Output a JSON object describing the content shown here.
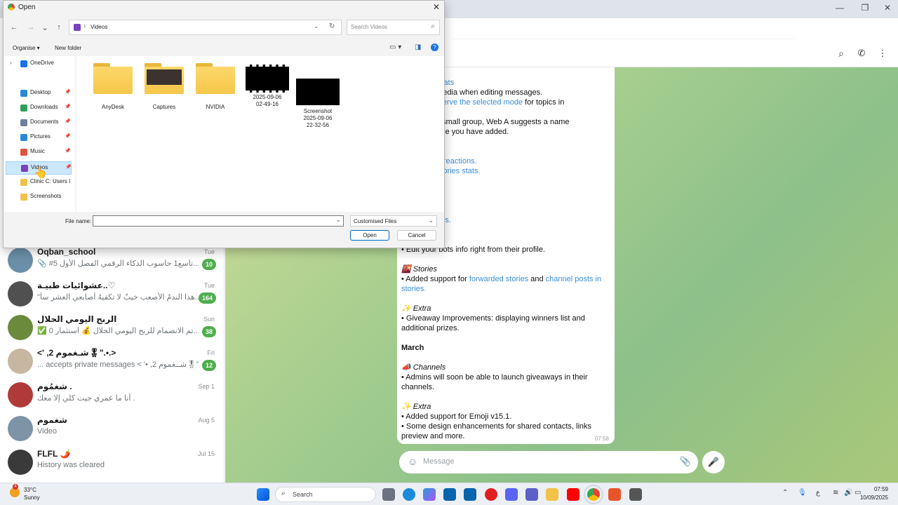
{
  "browser": {
    "profile_initial": "G",
    "icons": [
      "install-app-icon",
      "star-icon",
      "download-icon",
      "profile-avatar",
      "kebab-menu-icon"
    ]
  },
  "telegram": {
    "header_icons": [
      "search-icon",
      "phone-icon",
      "more-icon"
    ],
    "chats": [
      {
        "name": "Oqban_school",
        "message": "📎 #تاسع1 حاسوب الذكاء الرقمي الفصل الأول 5...",
        "time": "Tue",
        "badge": "10",
        "avatar_color": "#6b8fa8"
      },
      {
        "name": "عشوائيات طبيـة..♡",
        "message": "\"هذا الندمُ الأصعب خيبٌ لا تكفيهُ أصابعي العشر سأ...",
        "time": "Tue",
        "badge": "164",
        "avatar_color": "#505050"
      },
      {
        "name": "الربح اليومي الحلال",
        "message": "✅ تم الانضمام للربح اليومي الحلال 💰 استثمار 0...",
        "time": "Sun",
        "badge": "38",
        "avatar_color": "#6b8a3c"
      },
      {
        "name": "<' ,شـغموم 2🎖\".•.>",
        "message": "... accepts private messages < '• ,شــغموم 2🎖\"",
        "time": "Fri",
        "badge": "12",
        "avatar_color": "#c7b7a0"
      },
      {
        "name": "شغمُوم .",
        "message": "أنا ما عمري جيت كلي إلا معك .",
        "time": "Sep 1",
        "badge": "",
        "avatar_color": "#b03a3a"
      },
      {
        "name": "شغموم",
        "message": "Video",
        "time": "Aug 5",
        "badge": "",
        "avatar_color": "#7d93a6"
      },
      {
        "name": "FLFL 🌶️",
        "message": "History was cleared",
        "time": "Jul 15",
        "badge": "",
        "avatar_color": "#3a3a3a"
      }
    ],
    "bubble": {
      "time": "07:58",
      "lines": [
        {
          "text": "n Private Chats",
          "cls": "b-link"
        },
        {
          "text": "w replace media when editing messages.",
          "cls": ""
        },
        {
          "text": "rned to ",
          "cls": "",
          "link": "preserve the selected mode",
          "after": " for topics in"
        },
        {
          "text": "",
          "cls": ""
        },
        {
          "text": "ou create a small group, Web A suggests a name",
          "cls": ""
        },
        {
          "text": "n users' name you have added.",
          "cls": ""
        },
        {
          "text": "",
          "cls": ""
        },
        {
          "text": "",
          "cls": ""
        },
        {
          "text": "om channel reactions.",
          "cls": "b-link"
        },
        {
          "text": "d ",
          "cls": "",
          "link": "channel stories stats.",
          "after": ""
        },
        {
          "text": "oji statuses.",
          "cls": ""
        },
        {
          "text": "nnels.",
          "cls": "b-link"
        },
        {
          "text": "",
          "cls": ""
        },
        {
          "text": "",
          "cls": ""
        },
        {
          "text": "res for groups.",
          "cls": "b-link"
        },
        {
          "text": "",
          "cls": ""
        },
        {
          "text": "",
          "cls": ""
        },
        {
          "text": "• Edit your bots info right from their profile.",
          "cls": ""
        },
        {
          "text": "",
          "cls": ""
        },
        {
          "text": "🌇 Stories",
          "cls": "b-head"
        },
        {
          "text": "• Added support for ",
          "cls": "",
          "link": "forwarded stories",
          "after": " and ",
          "link2": "channel posts in"
        },
        {
          "text": "stories.",
          "cls": "b-link"
        },
        {
          "text": "",
          "cls": ""
        },
        {
          "text": "✨ Extra",
          "cls": "b-head"
        },
        {
          "text": "• Giveaway Improvements: displaying winners list and",
          "cls": ""
        },
        {
          "text": "additional prizes.",
          "cls": ""
        },
        {
          "text": "",
          "cls": ""
        },
        {
          "text": "March",
          "cls": "b-month"
        },
        {
          "text": "",
          "cls": ""
        },
        {
          "text": "📣 Channels",
          "cls": "b-head"
        },
        {
          "text": "• Admins will soon be able to launch giveaways in their",
          "cls": ""
        },
        {
          "text": "channels.",
          "cls": ""
        },
        {
          "text": "",
          "cls": ""
        },
        {
          "text": "✨ Extra",
          "cls": "b-head"
        },
        {
          "text": "• Added support for Emoji v15.1.",
          "cls": ""
        },
        {
          "text": "• Some design enhancements for shared contacts, links",
          "cls": ""
        },
        {
          "text": "preview and more.",
          "cls": ""
        }
      ]
    },
    "composer_placeholder": "Message"
  },
  "dialog": {
    "title": "Open",
    "path": "Videos",
    "search_placeholder": "Search Videos",
    "organise": "Organise ▾",
    "new_folder": "New folder",
    "nav": [
      {
        "label": "OneDrive",
        "color": "#1a73e8",
        "pinned": false
      },
      {
        "label": "Desktop",
        "color": "#2b88d8",
        "pinned": true
      },
      {
        "label": "Downloads",
        "color": "#2f9e5a",
        "pinned": true
      },
      {
        "label": "Documents",
        "color": "#6e7fa0",
        "pinned": true
      },
      {
        "label": "Pictures",
        "color": "#2b88d8",
        "pinned": true
      },
      {
        "label": "Music",
        "color": "#e0533c",
        "pinned": true
      },
      {
        "label": "Videos",
        "color": "#7b3fbf",
        "pinned": true
      },
      {
        "label": "Clinic  C: Users I",
        "color": "#f2c14a",
        "pinned": false
      },
      {
        "label": "Screenshots",
        "color": "#f2c14a",
        "pinned": false
      }
    ],
    "items": [
      {
        "label": "AnyDesk",
        "kind": "folder"
      },
      {
        "label": "Captures",
        "kind": "folder-thumb"
      },
      {
        "label": "NVIDIA",
        "kind": "folder"
      },
      {
        "label": "2025-09-06\n02-49-16",
        "kind": "video"
      },
      {
        "label": "Screenshot\n2025-09-06\n22-32-56",
        "kind": "black"
      }
    ],
    "filename_label": "File name:",
    "filename_value": "",
    "filetype": "Customised Files",
    "open_label": "Open",
    "cancel_label": "Cancel"
  },
  "taskbar": {
    "weather_temp": "33°C",
    "weather_desc": "Sunny",
    "weather_badge": "4",
    "search_label": "Search",
    "time": "07:59",
    "date": "10/09/2025",
    "lang": "ع"
  }
}
